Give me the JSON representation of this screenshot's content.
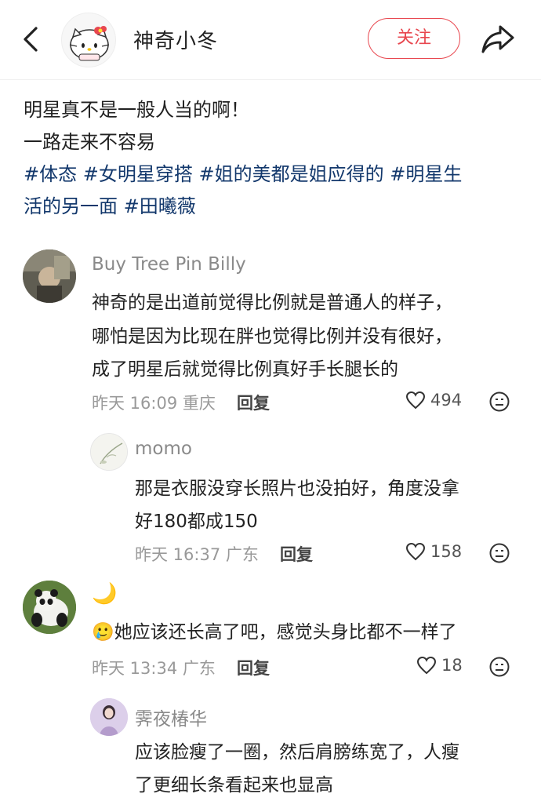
{
  "header": {
    "author": "神奇小冬",
    "follow_label": "关注"
  },
  "post": {
    "line1": "明星真不是一般人当的啊！",
    "line2": "一路走来不容易",
    "tags_line1": [
      "#体态",
      "#女明星穿搭",
      "#姐的美都是姐应得的",
      "#明星生"
    ],
    "tags_line2": [
      "活的另一面",
      "#田曦薇"
    ]
  },
  "comments": [
    {
      "name": "Buy Tree Pin Billy",
      "lines": [
        "神奇的是出道前觉得比例就是普通人的样子，",
        "哪怕是因为比现在胖也觉得比例并没有很好，",
        "成了明星后就觉得比例真好手长腿长的"
      ],
      "meta": "昨天 16:09 重庆",
      "reply": "回复",
      "likes": "494"
    },
    {
      "name": "momo",
      "lines": [
        "那是衣服没穿长照片也没拍好，角度没拿",
        "好180都成150"
      ],
      "meta": "昨天 16:37 广东",
      "reply": "回复",
      "likes": "158"
    },
    {
      "name": "🌙",
      "lines": [
        "她应该还长高了吧，感觉头身比都不一样了"
      ],
      "lead_emoji": "🥲",
      "meta": "昨天 13:34 广东",
      "reply": "回复",
      "likes": "18"
    },
    {
      "name": "霁夜椿华",
      "lines": [
        "应该脸瘦了一圈，然后肩膀练宽了，人瘦",
        "了更细长条看起来也显高"
      ]
    }
  ],
  "colors": {
    "accent": "#e8474f",
    "tag": "#13386c",
    "muted": "#999999"
  },
  "icons": [
    "back-arrow-icon",
    "share-icon",
    "heart-icon",
    "dislike-face-icon"
  ]
}
